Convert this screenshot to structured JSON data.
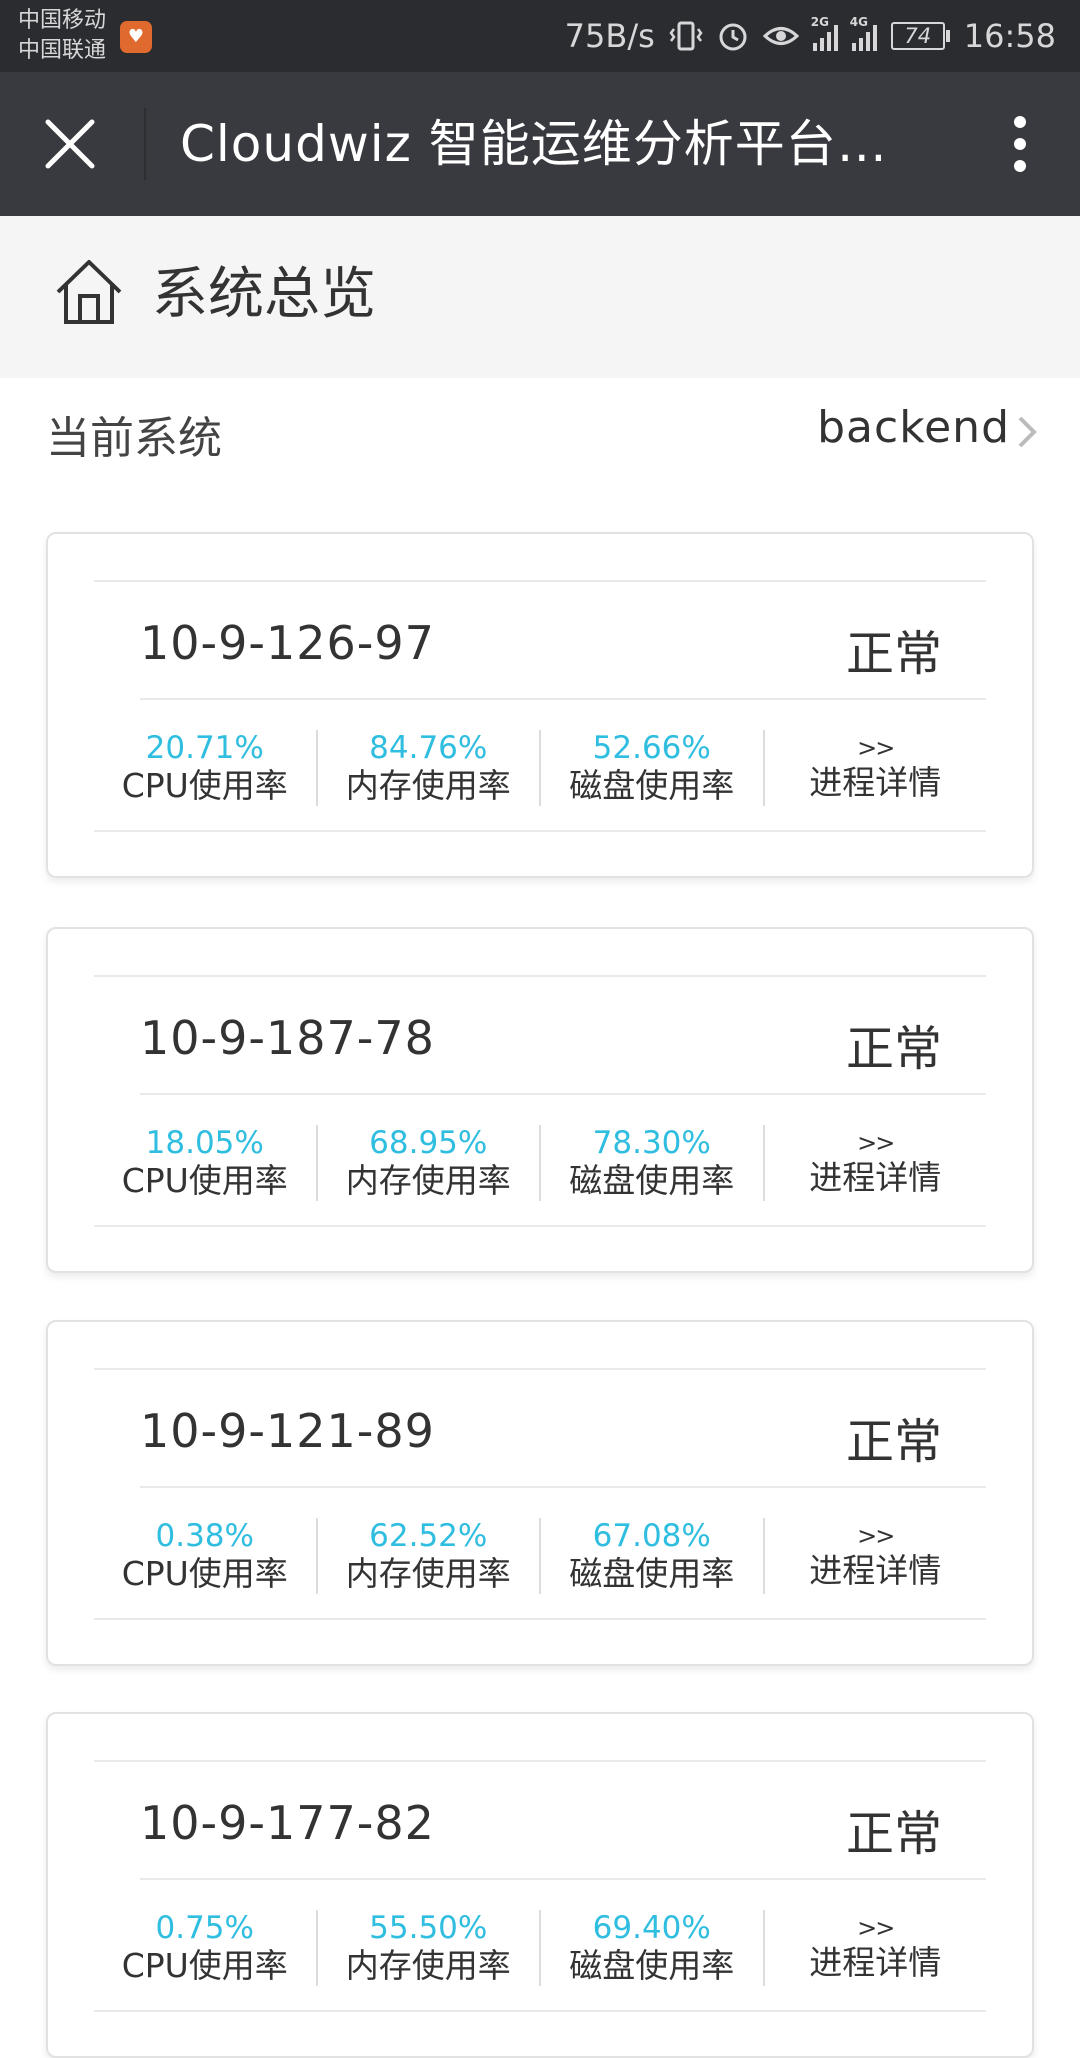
{
  "status_bar": {
    "carrier1": "中国移动",
    "carrier2": "中国联通",
    "net_speed": "75B/s",
    "network1": "2G",
    "network2": "4G",
    "battery": "74",
    "time": "16:58"
  },
  "nav": {
    "title": "Cloudwiz 智能运维分析平台…",
    "icons": {
      "close": "close-icon",
      "more": "more-vertical-icon"
    }
  },
  "page": {
    "title": "系统总览",
    "icon": "home-icon"
  },
  "current_system": {
    "label": "当前系统",
    "value": "backend"
  },
  "labels": {
    "cpu": "CPU使用率",
    "mem": "内存使用率",
    "disk": "磁盘使用率",
    "detail_arrow": ">>",
    "detail": "进程详情"
  },
  "hosts": [
    {
      "name": "10-9-126-97",
      "status": "正常",
      "cpu": "20.71%",
      "mem": "84.76%",
      "disk": "52.66%"
    },
    {
      "name": "10-9-187-78",
      "status": "正常",
      "cpu": "18.05%",
      "mem": "68.95%",
      "disk": "78.30%"
    },
    {
      "name": "10-9-121-89",
      "status": "正常",
      "cpu": "0.38%",
      "mem": "62.52%",
      "disk": "67.08%"
    },
    {
      "name": "10-9-177-82",
      "status": "正常",
      "cpu": "0.75%",
      "mem": "55.50%",
      "disk": "69.40%"
    }
  ],
  "colors": {
    "accent": "#2fbde0",
    "navbar": "#393a3f",
    "statusbar": "#2b2c30"
  }
}
